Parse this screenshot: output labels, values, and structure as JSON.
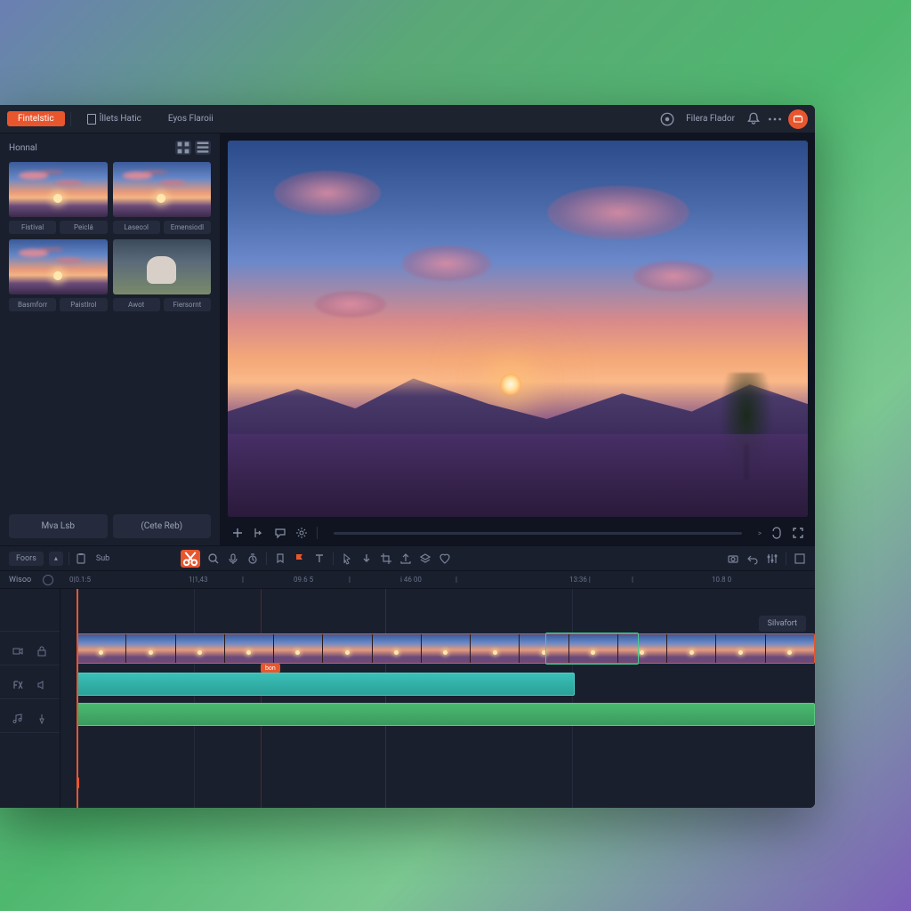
{
  "topbar": {
    "tab_active": "Fintelstic",
    "tab_2": "Îllets Hatic",
    "tab_3": "Eyos Flaroii",
    "right_label": "Filera Flador"
  },
  "media": {
    "title": "Honnal",
    "items": [
      {
        "label_a": "Fistival",
        "label_b": "Peiclá"
      },
      {
        "label_a": "Laseoɔl",
        "label_b": "Emensiodl"
      },
      {
        "label_a": "Basmforr",
        "label_b": "Paistlrol"
      },
      {
        "label_a": "Awot",
        "label_b": "Fiersornt"
      }
    ],
    "btn_left": "Mva Lsb",
    "btn_right": "(Cete Reb)"
  },
  "preview": {
    "time_text": ">"
  },
  "toolbar": {
    "left_label": "Foors",
    "sub_label": "Sub"
  },
  "ruler": {
    "track_label": "Wisoo",
    "marks": [
      "0|0.1:5",
      "1|1,43",
      "|",
      "09.6 5",
      "|",
      "i 46 00",
      "|",
      "13:36 |",
      "|",
      "10.8 0"
    ]
  },
  "timeline": {
    "snapshot": "Silvafort",
    "clip_marker": "bon"
  },
  "colors": {
    "accent": "#e8562e",
    "teal": "#3ac0b8",
    "green": "#4aba6f"
  }
}
